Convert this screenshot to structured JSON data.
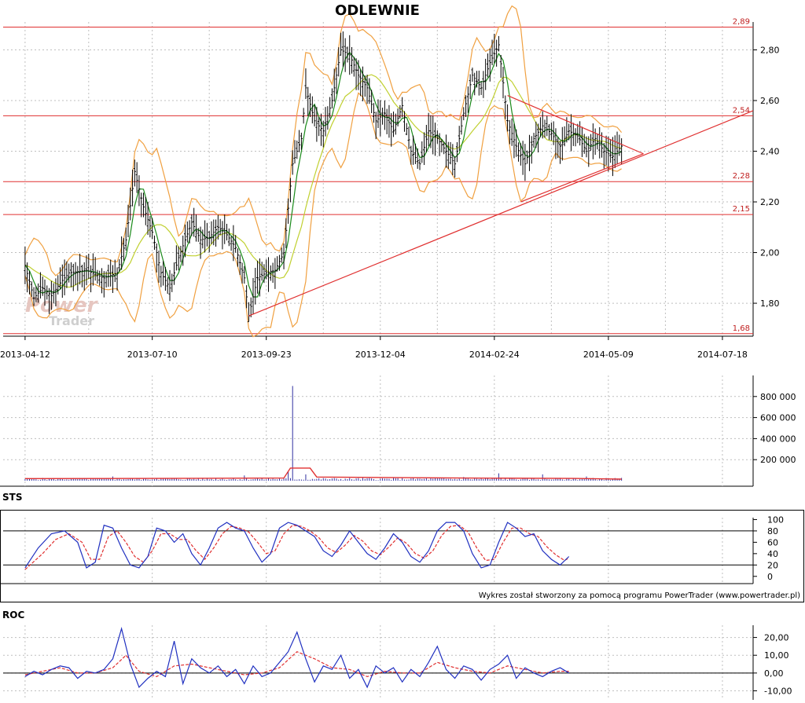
{
  "title": "ODLEWNIE",
  "watermark": {
    "line1": "Power",
    "line2": "Trader"
  },
  "credit": "Wykres został stworzony za pomocą programu PowerTrader (www.powertrader.pl)",
  "colors": {
    "price_bar": "#000000",
    "bollinger": "#f0a040",
    "ma_short": "#1a8a1a",
    "ma_long": "#c0d030",
    "level_line": "#e03030",
    "trend_line": "#e03030",
    "volume_bar": "#3030a0",
    "volume_avg": "#e03030",
    "osc_main": "#2030c0",
    "osc_signal": "#e03030",
    "grid": "#bfbfbf",
    "axis_text": "#000000",
    "level_text": "#c02020"
  },
  "chart_data": [
    {
      "name": "price",
      "type": "ohlc",
      "x_labels": [
        "2013-04-12",
        "2013-07-10",
        "2013-09-23",
        "2013-12-04",
        "2014-02-24",
        "2014-05-09",
        "2014-07-18"
      ],
      "x_label_positions": [
        0,
        58,
        110,
        162,
        214,
        266,
        318
      ],
      "x_range": [
        -10,
        332
      ],
      "y_ticks": [
        "1,80",
        "2,00",
        "2,20",
        "2,40",
        "2,60",
        "2,80"
      ],
      "y_tick_values": [
        1.8,
        2.0,
        2.2,
        2.4,
        2.6,
        2.8
      ],
      "ylim": [
        1.67,
        2.91
      ],
      "levels": [
        {
          "value": 2.89,
          "label": "2,89"
        },
        {
          "value": 2.54,
          "label": "2,54"
        },
        {
          "value": 2.28,
          "label": "2,28"
        },
        {
          "value": 2.15,
          "label": "2,15"
        },
        {
          "value": 1.68,
          "label": "1,68"
        }
      ],
      "trend_lines": [
        {
          "x1": 102,
          "y1": 1.75,
          "x2": 332,
          "y2": 2.56
        },
        {
          "x1": 220,
          "y1": 2.62,
          "x2": 282,
          "y2": 2.39
        },
        {
          "x1": 226,
          "y1": 2.2,
          "x2": 282,
          "y2": 2.39
        }
      ],
      "close_path": [
        [
          0,
          1.95
        ],
        [
          4,
          1.82
        ],
        [
          8,
          1.86
        ],
        [
          12,
          1.83
        ],
        [
          16,
          1.88
        ],
        [
          20,
          1.92
        ],
        [
          28,
          1.93
        ],
        [
          36,
          1.9
        ],
        [
          42,
          1.92
        ],
        [
          46,
          2.05
        ],
        [
          50,
          2.32
        ],
        [
          54,
          2.18
        ],
        [
          58,
          2.08
        ],
        [
          62,
          1.92
        ],
        [
          66,
          1.86
        ],
        [
          70,
          1.98
        ],
        [
          76,
          2.12
        ],
        [
          80,
          2.05
        ],
        [
          84,
          2.06
        ],
        [
          88,
          2.1
        ],
        [
          92,
          2.07
        ],
        [
          96,
          2.02
        ],
        [
          100,
          1.9
        ],
        [
          102,
          1.75
        ],
        [
          106,
          1.9
        ],
        [
          110,
          1.92
        ],
        [
          114,
          1.93
        ],
        [
          118,
          2.0
        ],
        [
          122,
          2.35
        ],
        [
          126,
          2.45
        ],
        [
          128,
          2.65
        ],
        [
          132,
          2.52
        ],
        [
          136,
          2.48
        ],
        [
          140,
          2.6
        ],
        [
          144,
          2.8
        ],
        [
          148,
          2.78
        ],
        [
          152,
          2.7
        ],
        [
          156,
          2.65
        ],
        [
          160,
          2.52
        ],
        [
          164,
          2.55
        ],
        [
          168,
          2.48
        ],
        [
          172,
          2.58
        ],
        [
          176,
          2.4
        ],
        [
          180,
          2.35
        ],
        [
          184,
          2.48
        ],
        [
          188,
          2.45
        ],
        [
          192,
          2.4
        ],
        [
          196,
          2.35
        ],
        [
          200,
          2.55
        ],
        [
          204,
          2.7
        ],
        [
          208,
          2.65
        ],
        [
          212,
          2.75
        ],
        [
          216,
          2.82
        ],
        [
          220,
          2.52
        ],
        [
          224,
          2.42
        ],
        [
          228,
          2.35
        ],
        [
          232,
          2.45
        ],
        [
          236,
          2.5
        ],
        [
          240,
          2.47
        ],
        [
          244,
          2.42
        ],
        [
          248,
          2.48
        ],
        [
          252,
          2.46
        ],
        [
          256,
          2.4
        ],
        [
          260,
          2.45
        ],
        [
          264,
          2.4
        ],
        [
          268,
          2.38
        ],
        [
          272,
          2.42
        ]
      ]
    },
    {
      "name": "volume",
      "type": "bar",
      "y_ticks": [
        "200 000",
        "400 000",
        "600 000",
        "800 000"
      ],
      "y_tick_values": [
        200000,
        400000,
        600000,
        800000
      ],
      "ylim": [
        0,
        1000000
      ],
      "spikes": [
        [
          40,
          40000
        ],
        [
          60,
          25000
        ],
        [
          100,
          50000
        ],
        [
          120,
          90000
        ],
        [
          122,
          900000
        ],
        [
          128,
          60000
        ],
        [
          200,
          35000
        ],
        [
          216,
          70000
        ],
        [
          236,
          60000
        ],
        [
          256,
          40000
        ]
      ],
      "base_volume": 18000,
      "average_line": [
        [
          0,
          20000
        ],
        [
          60,
          22000
        ],
        [
          118,
          25000
        ],
        [
          121,
          120000
        ],
        [
          130,
          120000
        ],
        [
          133,
          35000
        ],
        [
          200,
          25000
        ],
        [
          250,
          22000
        ],
        [
          272,
          15000
        ]
      ]
    },
    {
      "name": "STS",
      "type": "line",
      "title": "STS",
      "y_ticks": [
        "0",
        "20",
        "40",
        "60",
        "80",
        "100"
      ],
      "y_tick_values": [
        0,
        20,
        40,
        60,
        80,
        100
      ],
      "ylim": [
        -10,
        102
      ],
      "levels": [
        20,
        80
      ],
      "series_main": [
        [
          0,
          15
        ],
        [
          6,
          50
        ],
        [
          12,
          75
        ],
        [
          18,
          80
        ],
        [
          24,
          60
        ],
        [
          28,
          15
        ],
        [
          32,
          25
        ],
        [
          36,
          90
        ],
        [
          40,
          85
        ],
        [
          44,
          50
        ],
        [
          48,
          20
        ],
        [
          52,
          15
        ],
        [
          56,
          35
        ],
        [
          60,
          85
        ],
        [
          64,
          80
        ],
        [
          68,
          60
        ],
        [
          72,
          75
        ],
        [
          76,
          40
        ],
        [
          80,
          20
        ],
        [
          84,
          50
        ],
        [
          88,
          85
        ],
        [
          92,
          95
        ],
        [
          96,
          85
        ],
        [
          100,
          80
        ],
        [
          104,
          50
        ],
        [
          108,
          25
        ],
        [
          112,
          40
        ],
        [
          116,
          85
        ],
        [
          120,
          95
        ],
        [
          124,
          90
        ],
        [
          128,
          80
        ],
        [
          132,
          70
        ],
        [
          136,
          45
        ],
        [
          140,
          35
        ],
        [
          144,
          55
        ],
        [
          148,
          80
        ],
        [
          152,
          60
        ],
        [
          156,
          40
        ],
        [
          160,
          30
        ],
        [
          164,
          50
        ],
        [
          168,
          75
        ],
        [
          172,
          60
        ],
        [
          176,
          35
        ],
        [
          180,
          25
        ],
        [
          184,
          45
        ],
        [
          188,
          80
        ],
        [
          192,
          95
        ],
        [
          196,
          95
        ],
        [
          200,
          80
        ],
        [
          204,
          40
        ],
        [
          208,
          15
        ],
        [
          212,
          20
        ],
        [
          216,
          60
        ],
        [
          220,
          95
        ],
        [
          224,
          85
        ],
        [
          228,
          70
        ],
        [
          232,
          75
        ],
        [
          236,
          45
        ],
        [
          240,
          30
        ],
        [
          244,
          20
        ],
        [
          248,
          35
        ]
      ],
      "series_signal": [
        [
          0,
          12
        ],
        [
          8,
          40
        ],
        [
          14,
          65
        ],
        [
          20,
          75
        ],
        [
          26,
          60
        ],
        [
          30,
          30
        ],
        [
          34,
          30
        ],
        [
          38,
          70
        ],
        [
          42,
          80
        ],
        [
          46,
          60
        ],
        [
          50,
          35
        ],
        [
          54,
          25
        ],
        [
          58,
          45
        ],
        [
          62,
          75
        ],
        [
          66,
          75
        ],
        [
          70,
          65
        ],
        [
          74,
          65
        ],
        [
          78,
          45
        ],
        [
          82,
          30
        ],
        [
          86,
          50
        ],
        [
          90,
          75
        ],
        [
          94,
          88
        ],
        [
          98,
          85
        ],
        [
          102,
          78
        ],
        [
          106,
          60
        ],
        [
          110,
          40
        ],
        [
          114,
          45
        ],
        [
          118,
          75
        ],
        [
          122,
          90
        ],
        [
          126,
          88
        ],
        [
          130,
          80
        ],
        [
          134,
          68
        ],
        [
          138,
          50
        ],
        [
          142,
          42
        ],
        [
          146,
          55
        ],
        [
          150,
          72
        ],
        [
          154,
          62
        ],
        [
          158,
          45
        ],
        [
          162,
          38
        ],
        [
          166,
          52
        ],
        [
          170,
          68
        ],
        [
          174,
          58
        ],
        [
          178,
          40
        ],
        [
          182,
          32
        ],
        [
          186,
          45
        ],
        [
          190,
          72
        ],
        [
          194,
          88
        ],
        [
          198,
          90
        ],
        [
          202,
          78
        ],
        [
          206,
          50
        ],
        [
          210,
          28
        ],
        [
          214,
          30
        ],
        [
          218,
          60
        ],
        [
          222,
          85
        ],
        [
          226,
          85
        ],
        [
          230,
          75
        ],
        [
          234,
          70
        ],
        [
          238,
          52
        ],
        [
          242,
          38
        ],
        [
          246,
          28
        ],
        [
          248,
          32
        ]
      ]
    },
    {
      "name": "ROC",
      "type": "line",
      "title": "ROC",
      "y_ticks": [
        "-10,00",
        "0,00",
        "10,00",
        "20,00"
      ],
      "y_tick_values": [
        -10,
        0,
        10,
        20
      ],
      "ylim": [
        -12,
        26
      ],
      "zero_line": 0,
      "series_main": [
        [
          0,
          -2
        ],
        [
          4,
          1
        ],
        [
          8,
          -1
        ],
        [
          12,
          2
        ],
        [
          16,
          4
        ],
        [
          20,
          3
        ],
        [
          24,
          -3
        ],
        [
          28,
          1
        ],
        [
          32,
          0
        ],
        [
          36,
          2
        ],
        [
          40,
          8
        ],
        [
          44,
          25
        ],
        [
          48,
          5
        ],
        [
          52,
          -8
        ],
        [
          56,
          -3
        ],
        [
          60,
          1
        ],
        [
          64,
          -2
        ],
        [
          68,
          18
        ],
        [
          72,
          -6
        ],
        [
          76,
          8
        ],
        [
          80,
          3
        ],
        [
          84,
          0
        ],
        [
          88,
          4
        ],
        [
          92,
          -2
        ],
        [
          96,
          2
        ],
        [
          100,
          -6
        ],
        [
          104,
          4
        ],
        [
          108,
          -2
        ],
        [
          112,
          0
        ],
        [
          116,
          6
        ],
        [
          120,
          12
        ],
        [
          124,
          23
        ],
        [
          128,
          8
        ],
        [
          132,
          -5
        ],
        [
          136,
          4
        ],
        [
          140,
          2
        ],
        [
          144,
          10
        ],
        [
          148,
          -3
        ],
        [
          152,
          2
        ],
        [
          156,
          -8
        ],
        [
          160,
          4
        ],
        [
          164,
          0
        ],
        [
          168,
          3
        ],
        [
          172,
          -5
        ],
        [
          176,
          2
        ],
        [
          180,
          -2
        ],
        [
          184,
          6
        ],
        [
          188,
          15
        ],
        [
          192,
          2
        ],
        [
          196,
          -3
        ],
        [
          200,
          4
        ],
        [
          204,
          2
        ],
        [
          208,
          -4
        ],
        [
          212,
          2
        ],
        [
          216,
          5
        ],
        [
          220,
          10
        ],
        [
          224,
          -3
        ],
        [
          228,
          3
        ],
        [
          232,
          0
        ],
        [
          236,
          -2
        ],
        [
          240,
          1
        ],
        [
          244,
          3
        ],
        [
          248,
          0
        ]
      ],
      "series_signal": [
        [
          0,
          -1
        ],
        [
          8,
          1
        ],
        [
          16,
          3
        ],
        [
          24,
          0
        ],
        [
          32,
          0
        ],
        [
          40,
          3
        ],
        [
          46,
          10
        ],
        [
          52,
          1
        ],
        [
          60,
          -2
        ],
        [
          68,
          4
        ],
        [
          76,
          5
        ],
        [
          84,
          3
        ],
        [
          92,
          1
        ],
        [
          100,
          -1
        ],
        [
          108,
          0
        ],
        [
          116,
          3
        ],
        [
          124,
          12
        ],
        [
          132,
          8
        ],
        [
          140,
          3
        ],
        [
          148,
          2
        ],
        [
          156,
          -2
        ],
        [
          164,
          1
        ],
        [
          172,
          0
        ],
        [
          180,
          0
        ],
        [
          188,
          6
        ],
        [
          196,
          3
        ],
        [
          204,
          1
        ],
        [
          212,
          0
        ],
        [
          220,
          4
        ],
        [
          228,
          2
        ],
        [
          236,
          0
        ],
        [
          244,
          1
        ],
        [
          248,
          1
        ]
      ]
    }
  ]
}
